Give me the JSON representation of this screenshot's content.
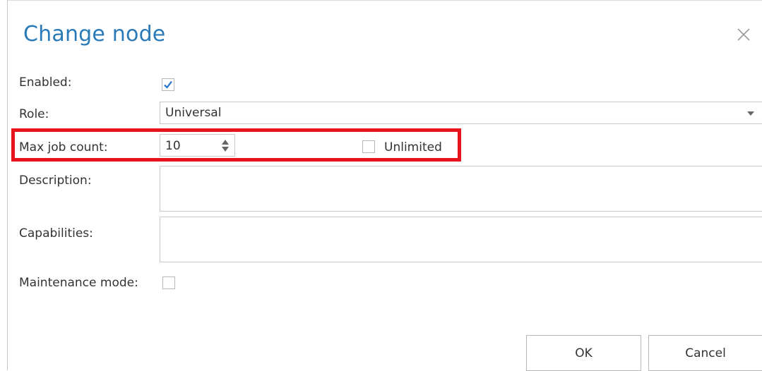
{
  "dialog": {
    "title": "Change node",
    "close_icon": "close-icon"
  },
  "form": {
    "enabled": {
      "label": "Enabled:",
      "checked": true
    },
    "role": {
      "label": "Role:",
      "value": "Universal"
    },
    "max_job_count": {
      "label": "Max job count:",
      "value": "10"
    },
    "unlimited": {
      "label": "Unlimited",
      "checked": false
    },
    "description": {
      "label": "Description:",
      "value": ""
    },
    "capabilities": {
      "label": "Capabilities:",
      "value": ""
    },
    "maintenance_mode": {
      "label": "Maintenance mode:",
      "checked": false
    }
  },
  "buttons": {
    "ok": "OK",
    "cancel": "Cancel"
  },
  "colors": {
    "title": "#2a7ab8",
    "checkmark": "#1e73c8",
    "highlight": "#e8141c"
  }
}
